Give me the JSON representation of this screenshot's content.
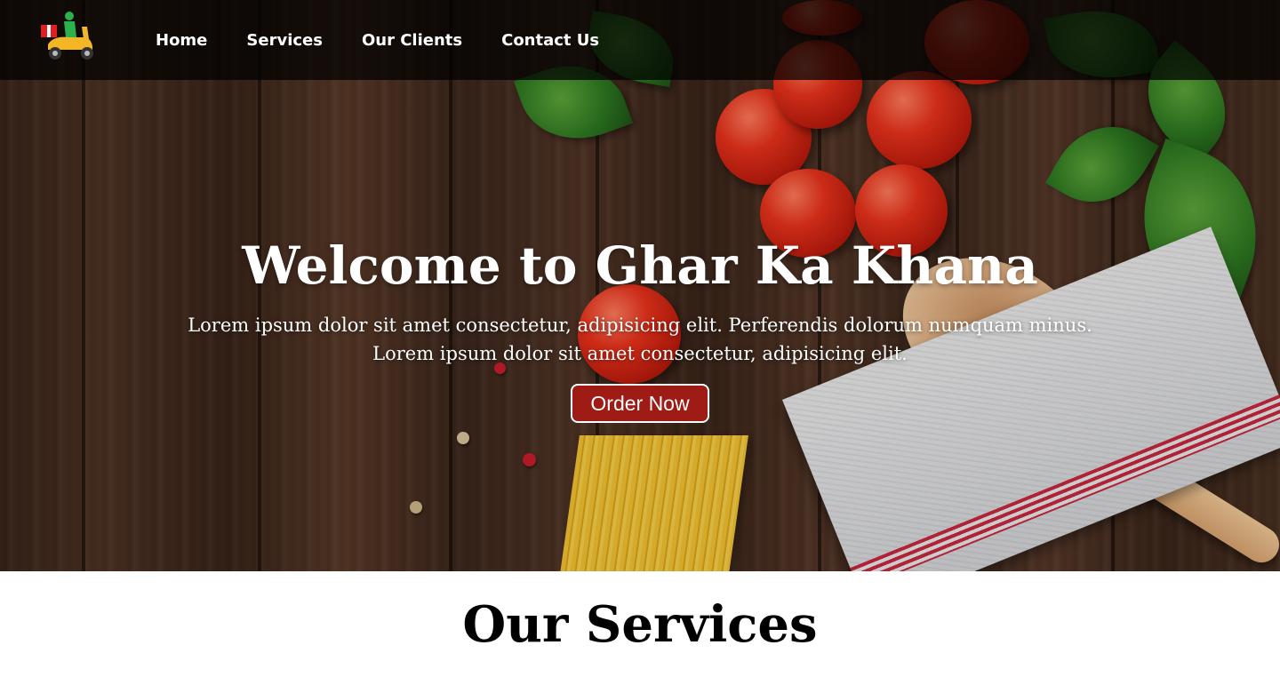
{
  "navbar": {
    "logo_icon": "scooter-delivery-logo-icon",
    "links": [
      "Home",
      "Services",
      "Our Clients",
      "Contact Us"
    ]
  },
  "hero": {
    "title": "Welcome to Ghar Ka Khana",
    "text_line1": "Lorem ipsum dolor sit amet consectetur, adipisicing elit. Perferendis dolorum numquam minus.",
    "text_line2": "Lorem ipsum dolor sit amet consectetur, adipisicing elit.",
    "cta_label": "Order Now",
    "cta_color": "#9e1b16"
  },
  "services": {
    "heading": "Our Services"
  }
}
